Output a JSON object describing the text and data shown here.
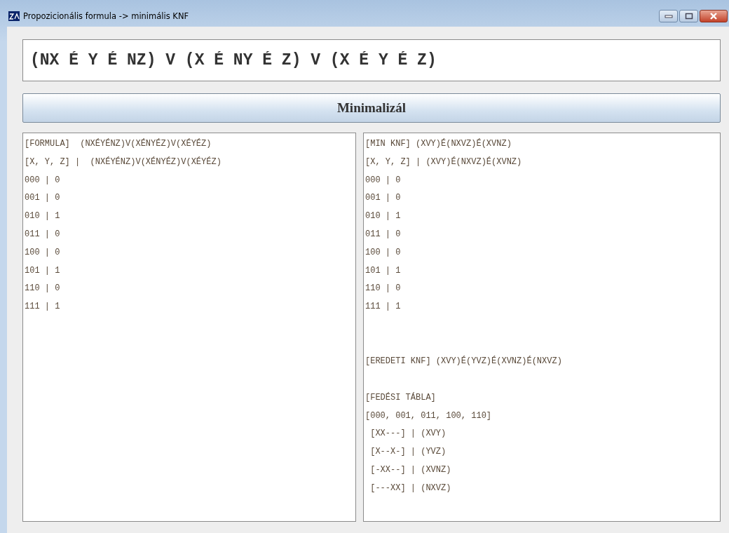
{
  "window": {
    "title": "Propozicionális formula -> minimális KNF"
  },
  "formula_field": {
    "value": "(NX É Y É NZ) V (X É NY É Z) V (X É Y É Z)"
  },
  "minimize_button": {
    "label": "Minimalizál"
  },
  "panels": [
    {
      "sections": [
        {
          "lines": [
            "[FORMULA]  (NXÉYÉNZ)V(XÉNYÉZ)V(XÉYÉZ)",
            "[X, Y, Z] |  (NXÉYÉNZ)V(XÉNYÉZ)V(XÉYÉZ)",
            "000 | 0",
            "001 | 0",
            "010 | 1",
            "011 | 0",
            "100 | 0",
            "101 | 1",
            "110 | 0",
            "111 | 1"
          ]
        }
      ]
    },
    {
      "sections": [
        {
          "lines": [
            "[MIN KNF] (XVY)É(NXVZ)É(XVNZ)",
            "[X, Y, Z] | (XVY)É(NXVZ)É(XVNZ)",
            "000 | 0",
            "001 | 0",
            "010 | 1",
            "011 | 0",
            "100 | 0",
            "101 | 1",
            "110 | 0",
            "111 | 1"
          ]
        },
        {
          "lines": [
            "[EREDETI KNF] (XVY)É(YVZ)É(XVNZ)É(NXVZ)"
          ]
        },
        {
          "lines": [
            "[FEDÉSI TÁBLA]",
            "[000, 001, 011, 100, 110]",
            " [XX---] | (XVY)",
            " [X--X-] | (YVZ)",
            " [-XX--] | (XVNZ)",
            " [---XX] | (NXVZ)"
          ]
        }
      ]
    }
  ]
}
